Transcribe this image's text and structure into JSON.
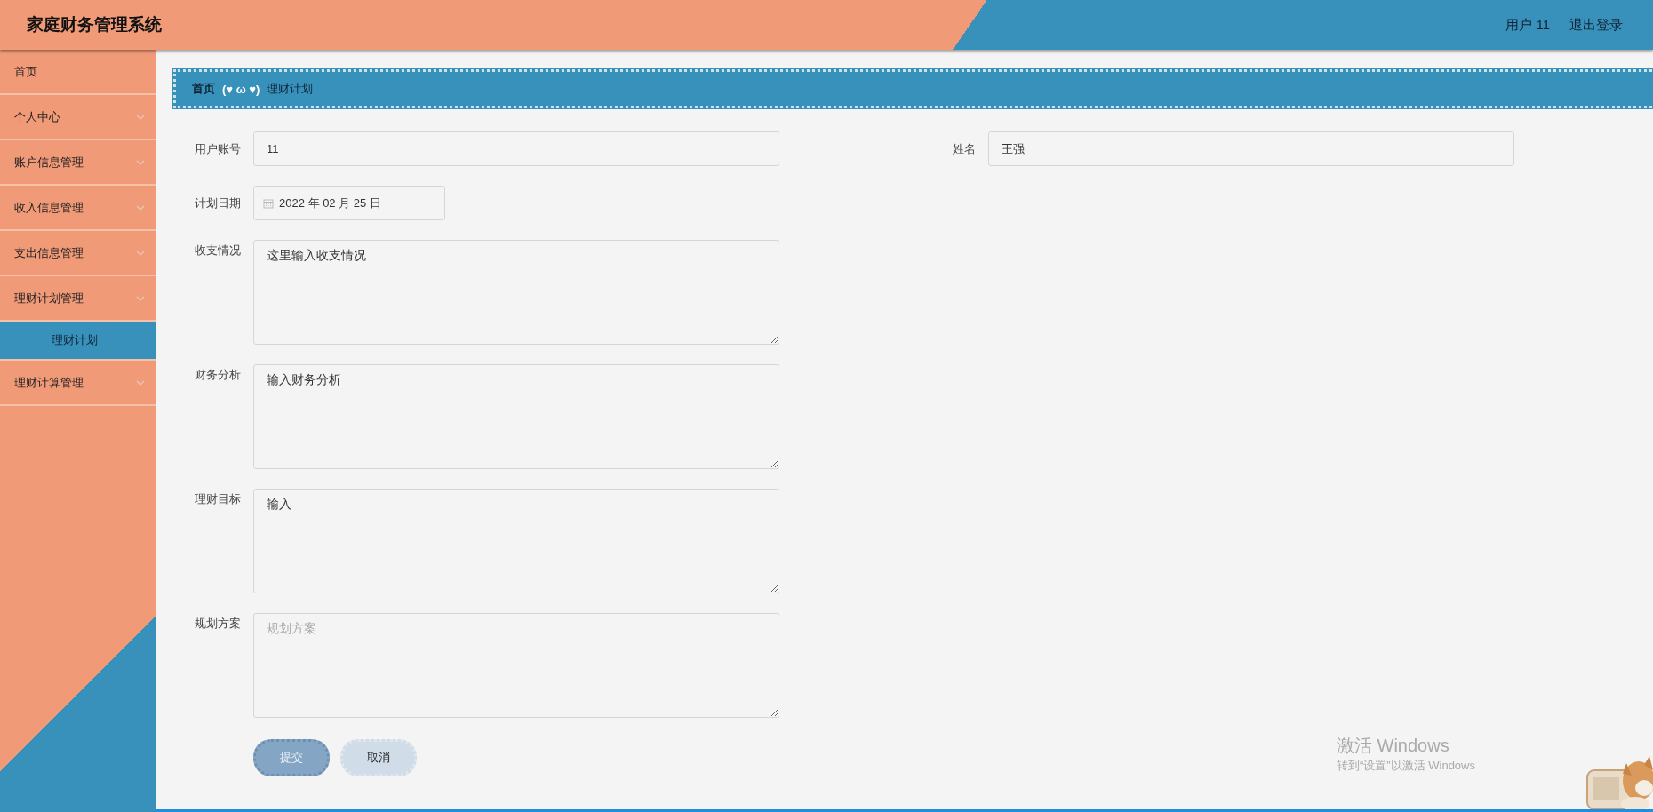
{
  "header": {
    "title": "家庭财务管理系统",
    "user": "用户 11",
    "logout": "退出登录"
  },
  "sidebar": {
    "items": [
      {
        "label": "首页",
        "kind": "link",
        "selected": false
      },
      {
        "label": "个人中心",
        "kind": "group"
      },
      {
        "label": "账户信息管理",
        "kind": "group"
      },
      {
        "label": "收入信息管理",
        "kind": "group"
      },
      {
        "label": "支出信息管理",
        "kind": "group"
      },
      {
        "label": "理财计划管理",
        "kind": "group",
        "children": [
          {
            "label": "理财计划",
            "selected": true
          }
        ]
      },
      {
        "label": "理财计算管理",
        "kind": "group"
      }
    ]
  },
  "breadcrumb": {
    "home": "首页",
    "separator": "(♥ ω ♥)",
    "current": "理财计划"
  },
  "form": {
    "rows": [
      [
        {
          "label": "用户账号",
          "kind": "text",
          "value": "11"
        },
        {
          "label": "姓名",
          "kind": "text",
          "value": "王强"
        }
      ],
      [
        {
          "label": "计划日期",
          "kind": "date",
          "value": "2022 年 02 月 25 日"
        }
      ],
      [
        {
          "label": "收支情况",
          "kind": "textarea",
          "value": "这里输入收支情况"
        }
      ],
      [
        {
          "label": "财务分析",
          "kind": "textarea",
          "value": "输入财务分析"
        }
      ],
      [
        {
          "label": "理财目标",
          "kind": "textarea",
          "value": "输入"
        }
      ],
      [
        {
          "label": "规划方案",
          "kind": "textarea",
          "placeholder": "规划方案"
        }
      ]
    ],
    "buttons": [
      {
        "label": "提交",
        "kind": "primary"
      },
      {
        "label": "取消",
        "kind": "secondary"
      }
    ]
  },
  "os_notice": {
    "title": "激活 Windows",
    "subtitle": "转到“设置”以激活 Windows"
  }
}
